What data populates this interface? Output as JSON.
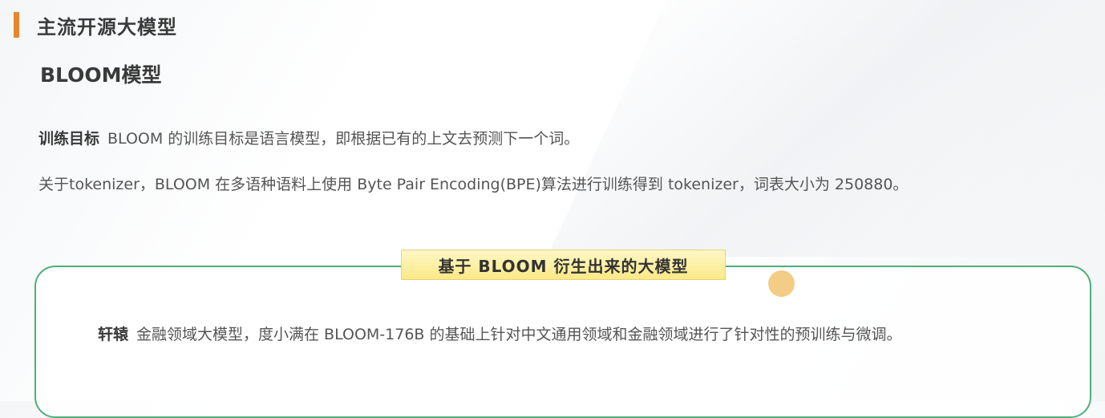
{
  "section": {
    "title": "主流开源大模型"
  },
  "model": {
    "title": "BLOOM模型"
  },
  "paragraphs": {
    "training_label": "训练目标",
    "training_text": "BLOOM 的训练目标是语言模型，即根据已有的上文去预测下一个词。",
    "tokenizer_text": "关于tokenizer，BLOOM 在多语种语料上使用 Byte Pair Encoding(BPE)算法进行训练得到 tokenizer，词表大小为 250880。"
  },
  "derived": {
    "label": "基于 BLOOM 衍生出来的大模型",
    "item_name": "轩辕",
    "item_text": "金融领域大模型，度小满在 BLOOM-176B 的基础上针对中文通用领域和金融领域进行了针对性的预训练与微调。"
  },
  "colors": {
    "accent": "#e8862c",
    "box_border": "#4fae7a",
    "label_bg": "#fbe986",
    "dot": "#f3cd85"
  }
}
